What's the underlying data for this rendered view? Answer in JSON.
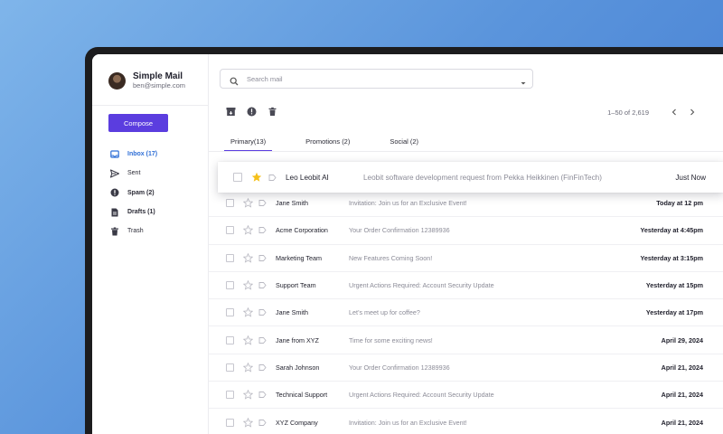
{
  "app": {
    "name": "Simple Mail",
    "email": "ben@simple.com"
  },
  "compose_label": "Compose",
  "nav": [
    {
      "label": "Inbox (17)",
      "icon": "inbox-icon"
    },
    {
      "label": "Sent",
      "icon": "send-icon"
    },
    {
      "label": "Spam (2)",
      "icon": "spam-icon"
    },
    {
      "label": "Drafts (1)",
      "icon": "draft-icon"
    },
    {
      "label": "Trash",
      "icon": "trash-icon"
    }
  ],
  "search": {
    "placeholder": "Search mail"
  },
  "pagination": {
    "range": "1–50 of 2,619"
  },
  "tabs": [
    {
      "label": "Primary(13)"
    },
    {
      "label": "Promotions (2)"
    },
    {
      "label": "Social (2)"
    }
  ],
  "highlighted_email": {
    "sender": "Leo Leobit AI",
    "subject": "Leobit software development request from Pekka Heikkinen (FinFinTech)",
    "time": "Just Now",
    "starred": true
  },
  "emails": [
    {
      "sender": "Jane Smith",
      "subject": "Invitation: Join us for an Exclusive Event!",
      "time": "Today at 12 pm"
    },
    {
      "sender": "Acme Corporation",
      "subject": "Your Order Confirmation 12389936",
      "time": "Yesterday at 4:45pm"
    },
    {
      "sender": "Marketing Team",
      "subject": "New Features Coming Soon!",
      "time": "Yesterday at 3:15pm"
    },
    {
      "sender": "Support Team",
      "subject": "Urgent Actions Required: Account Security Update",
      "time": "Yesterday at 15pm"
    },
    {
      "sender": "Jane Smith",
      "subject": "Let’s meet up for coffee?",
      "time": "Yesterday at 17pm"
    },
    {
      "sender": "Jane from XYZ",
      "subject": "Time for some exciting news!",
      "time": "April 29, 2024"
    },
    {
      "sender": "Sarah Johnson",
      "subject": "Your Order Confirmation 12389936",
      "time": "April 21, 2024"
    },
    {
      "sender": "Technical Support",
      "subject": "Urgent Actions Required: Account Security Update",
      "time": "April 21, 2024"
    },
    {
      "sender": "XYZ Company",
      "subject": "Invitation: Join us for an Exclusive Event!",
      "time": "April 21, 2024"
    }
  ],
  "colors": {
    "accent": "#5b3ddf",
    "active_nav": "#2f6fd6",
    "star": "#f5c01a"
  }
}
